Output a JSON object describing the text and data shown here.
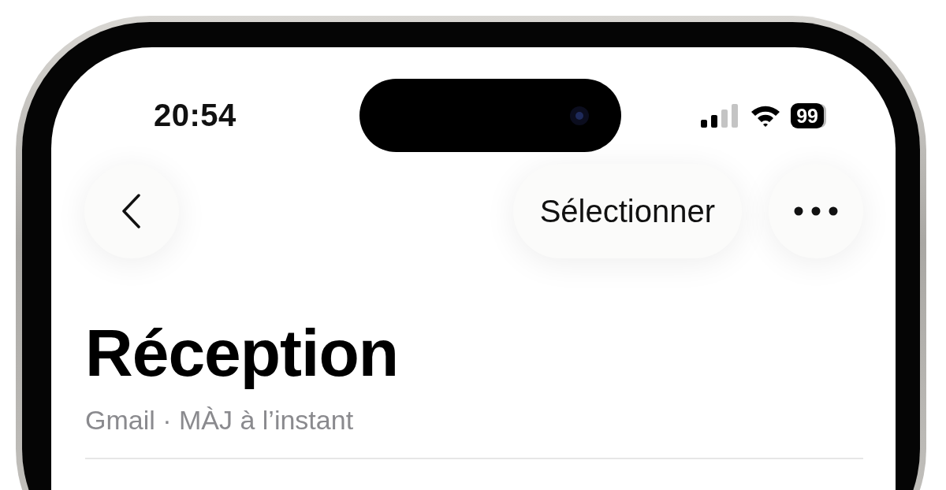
{
  "status_bar": {
    "time": "20:54",
    "battery": "99"
  },
  "nav": {
    "select_button": "Sélectionner"
  },
  "title": "Réception",
  "subtitle": "Gmail · MÀJ à l’instant"
}
